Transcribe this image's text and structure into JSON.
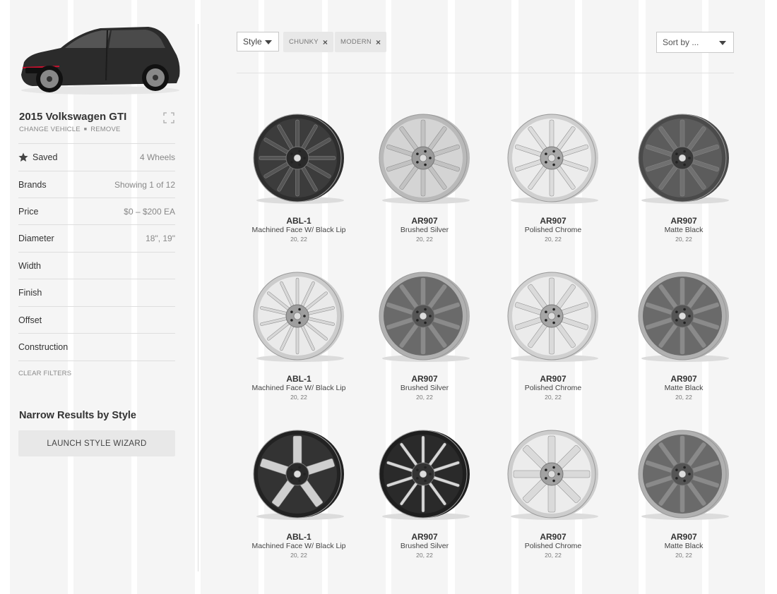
{
  "vehicle": {
    "name": "2015 Volkswagen GTI",
    "change_label": "CHANGE VEHICLE",
    "remove_label": "REMOVE"
  },
  "filters": [
    {
      "label": "Saved",
      "value": "4 Wheels",
      "icon": "star-icon"
    },
    {
      "label": "Brands",
      "value": "Showing 1 of 12"
    },
    {
      "label": "Price",
      "value": "$0 – $200 EA"
    },
    {
      "label": "Diameter",
      "value": "18\", 19\""
    },
    {
      "label": "Width",
      "value": ""
    },
    {
      "label": "Finish",
      "value": ""
    },
    {
      "label": "Offset",
      "value": ""
    },
    {
      "label": "Construction",
      "value": ""
    }
  ],
  "clear_filters": "CLEAR FILTERS",
  "narrow": {
    "title": "Narrow Results by Style",
    "button": "LAUNCH STYLE WIZARD"
  },
  "toolbar": {
    "style_select": "Style",
    "chips": [
      "CHUNKY",
      "MODERN"
    ],
    "sort_select": "Sort by ..."
  },
  "colors": {
    "stripe": "#f5f5f5",
    "chip_bg": "#e8e8e8",
    "text": "#333333",
    "muted": "#888888"
  },
  "products": [
    {
      "name": "ABL-1",
      "finish": "Machined Face W/ Black Lip",
      "sizes": "20, 22",
      "look": "dark-multispoke"
    },
    {
      "name": "AR907",
      "finish": "Brushed Silver",
      "sizes": "20, 22",
      "look": "silver-5split"
    },
    {
      "name": "AR907",
      "finish": "Polished Chrome",
      "sizes": "20, 22",
      "look": "chrome-5split"
    },
    {
      "name": "AR907",
      "finish": "Matte Black",
      "sizes": "20, 22",
      "look": "gunmetal-5split"
    },
    {
      "name": "ABL-1",
      "finish": "Machined Face W/ Black Lip",
      "sizes": "20, 22",
      "look": "chrome-mesh"
    },
    {
      "name": "AR907",
      "finish": "Brushed Silver",
      "sizes": "20, 22",
      "look": "gunmetal-10spoke"
    },
    {
      "name": "AR907",
      "finish": "Polished Chrome",
      "sizes": "20, 22",
      "look": "chrome-10spoke"
    },
    {
      "name": "AR907",
      "finish": "Matte Black",
      "sizes": "20, 22",
      "look": "gunmetal-10spoke"
    },
    {
      "name": "ABL-1",
      "finish": "Machined Face W/ Black Lip",
      "sizes": "20, 22",
      "look": "black-machined-5"
    },
    {
      "name": "AR907",
      "finish": "Brushed Silver",
      "sizes": "20, 22",
      "look": "black-machined-10"
    },
    {
      "name": "AR907",
      "finish": "Polished Chrome",
      "sizes": "20, 22",
      "look": "chrome-8spoke"
    },
    {
      "name": "AR907",
      "finish": "Matte Black",
      "sizes": "20, 22",
      "look": "gunmetal-10spoke"
    }
  ]
}
